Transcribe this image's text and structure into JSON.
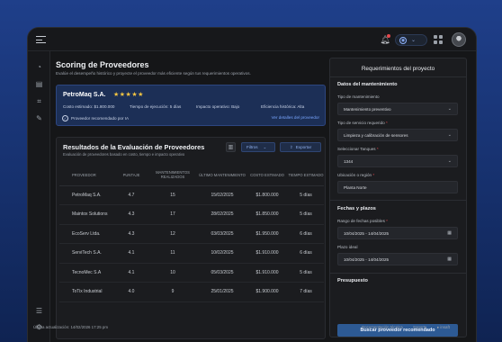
{
  "topbar": {
    "menu_icon": "hamburger-icon",
    "bell_icon": "bell-icon",
    "account_icon": "account-circle-icon",
    "apps_icon": "grid-icon",
    "avatar_icon": "user-avatar"
  },
  "sidebar": {
    "items": [
      {
        "icon": "dashboard-icon",
        "glyph": "◔"
      },
      {
        "icon": "document-icon",
        "glyph": "▤"
      },
      {
        "icon": "map-icon",
        "glyph": "⌗"
      },
      {
        "icon": "edit-icon",
        "glyph": "✎"
      }
    ],
    "bottom": [
      {
        "icon": "help-icon",
        "glyph": "☰"
      },
      {
        "icon": "settings-icon",
        "glyph": "⚙"
      }
    ]
  },
  "header": {
    "title": "Scoring de Proveedores",
    "subtitle": "Evalúe el desempeño histórico y proyecte el proveedor más eficiente según tus requerimientos operativos."
  },
  "recommended": {
    "name": "PetroMaq S.A.",
    "stars": "★★★★★",
    "rating": 5,
    "cost": "Costo estimado: $1.800.000",
    "time": "Tiempo de ejecución: 5 días",
    "impact": "Impacto operativo: Bajo",
    "efficiency": "Eficiencia histórica: Alta",
    "badge": "Proveedor recomendado por IA",
    "link": "Ver detalles del proveedor"
  },
  "results": {
    "title": "Resultados de la Evaluación de Proveedores",
    "subtitle": "Evaluación de proveedores basado en costo, tiempo e impacto operativo",
    "filter_label": "Filtros",
    "export_label": "Exportar",
    "columns": [
      "PROVEEDOR",
      "PUNTAJE",
      "MANTENIMIENTOS REALIZADOS",
      "ÚLTIMO MANTENIMIENTO",
      "COSTO ESTIMADO",
      "TIEMPO ESTIMADO"
    ],
    "rows": [
      [
        "PetroMaq S.A.",
        "4.7",
        "15",
        "15/02/2025",
        "$1.800.000",
        "5 días"
      ],
      [
        "Maintox Solutions",
        "4.3",
        "17",
        "28/02/2025",
        "$1.850.000",
        "5 días"
      ],
      [
        "EcoServ Ltda.",
        "4.3",
        "12",
        "03/03/2025",
        "$1.950.000",
        "6 días"
      ],
      [
        "ServiTech S.A.",
        "4.1",
        "11",
        "10/02/2025",
        "$1.910.000",
        "6 días"
      ],
      [
        "TecnoMec S.A",
        "4.1",
        "10",
        "05/03/2025",
        "$1.910.000",
        "5 días"
      ],
      [
        "ToTix Industrial",
        "4.0",
        "9",
        "25/01/2025",
        "$1.900.000",
        "7 días"
      ]
    ]
  },
  "footer": {
    "updated": "Última actualización: 14/02/2026 17:25 pm",
    "docs": "Documentación técnica",
    "support": "Soporte",
    "brand": "▸ insaft"
  },
  "requirements": {
    "title": "Requerimientos del proyecto",
    "maintenance_section": "Datos del mantenimiento",
    "maint_type_label": "Tipo de mantenimiento",
    "maint_type_value": "Mantenimiento preventivo",
    "service_type_label": "Tipo de servicio requerido",
    "service_type_value": "Limpieza y calibración de sensores",
    "tank_label": "Seleccionar Tanques",
    "tank_value": "1344",
    "location_label": "Ubicación o región",
    "location_value": "Planta Norte",
    "dates_section": "Fechas y plazos",
    "date_range_label": "Rango de fechas posibles",
    "date_range_value": "10/04/2025 - 14/04/2025",
    "ideal_label": "Plazo ideal",
    "ideal_value": "10/04/2025 - 14/04/2025",
    "budget_section": "Presupuesto",
    "submit_label": "Buscar proveedor recomendado"
  }
}
